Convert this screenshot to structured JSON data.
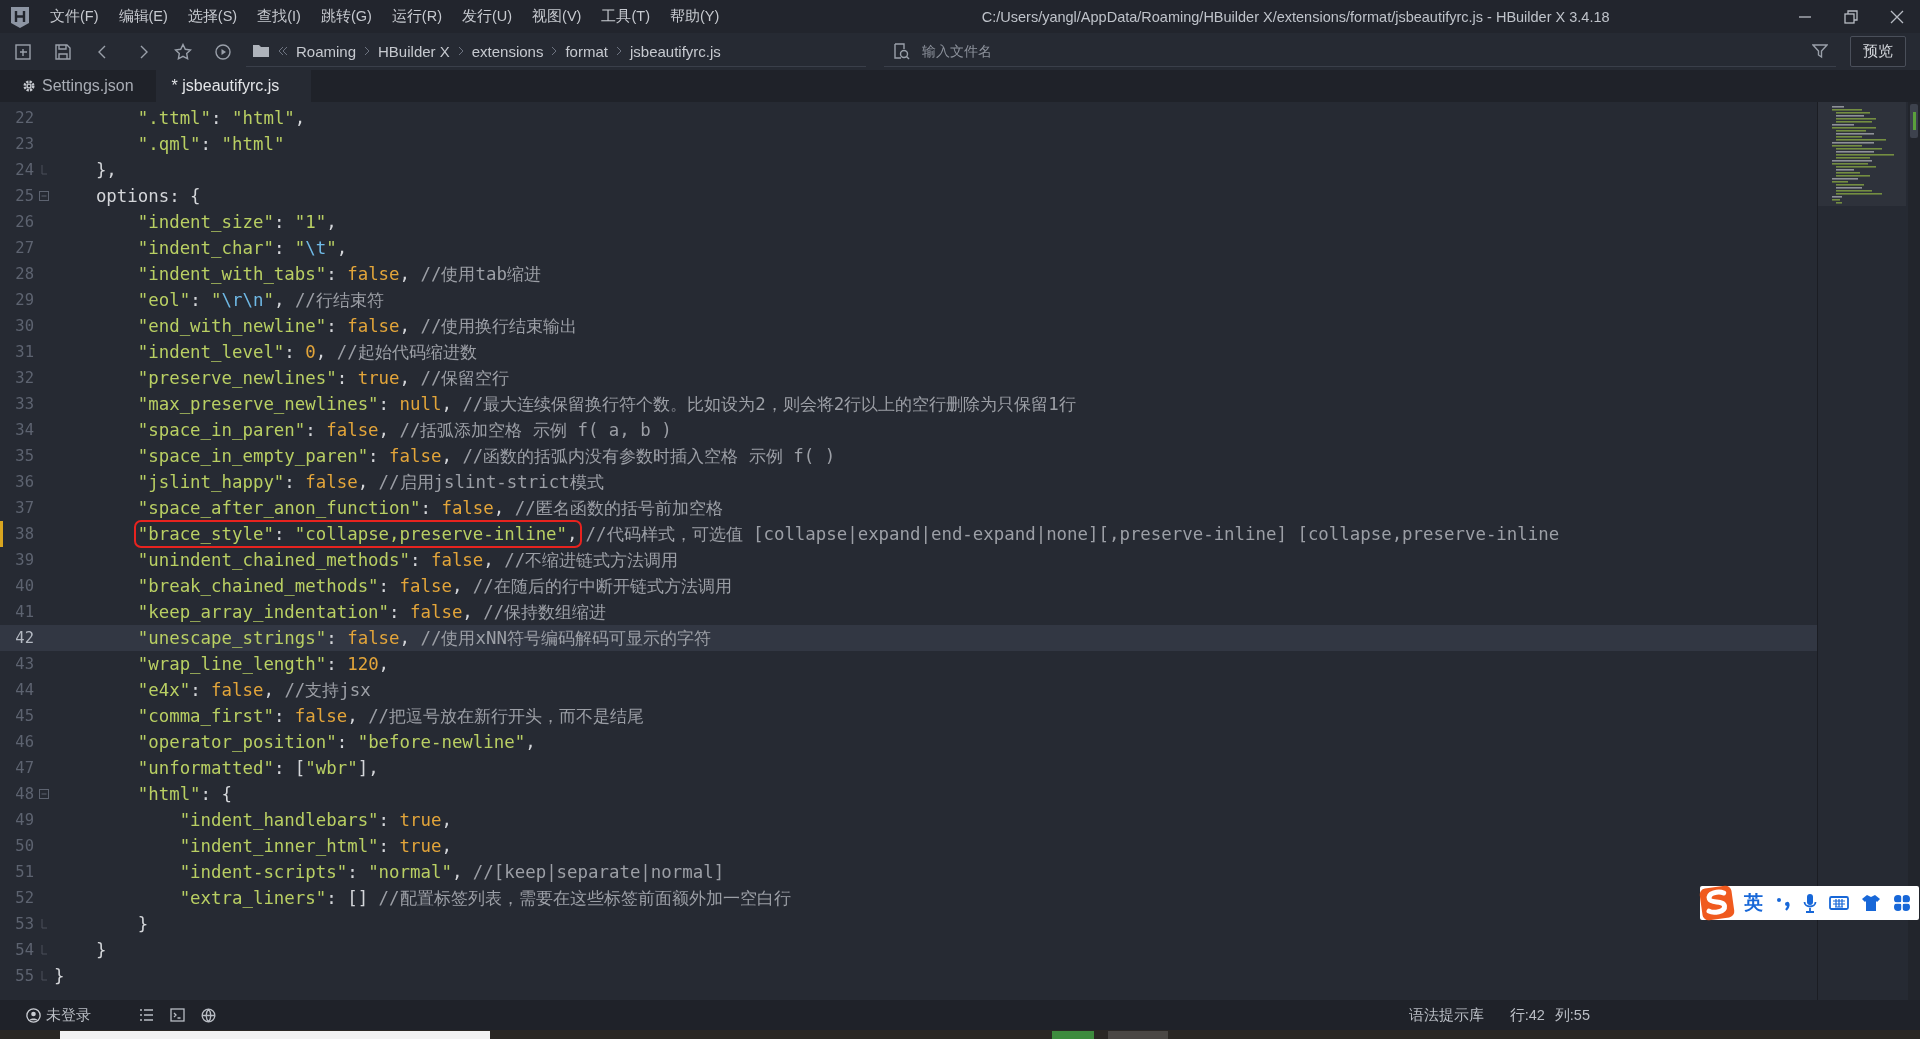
{
  "window": {
    "title": "C:/Users/yangl/AppData/Roaming/HBuilder X/extensions/format/jsbeautifyrc.js - HBuilder X 3.4.18"
  },
  "menu": [
    "文件(F)",
    "编辑(E)",
    "选择(S)",
    "查找(I)",
    "跳转(G)",
    "运行(R)",
    "发行(U)",
    "视图(V)",
    "工具(T)",
    "帮助(Y)"
  ],
  "toolbar": {
    "breadcrumb": [
      "Roaming",
      "HBuilder X",
      "extensions",
      "format",
      "jsbeautifyrc.js"
    ],
    "file_search": {
      "placeholder": "输入文件名"
    },
    "preview_button": "预览"
  },
  "tabs": [
    {
      "kind": "settings",
      "label": "Settings.json",
      "selected": false
    },
    {
      "kind": "file",
      "label": "* jsbeautifyrc.js",
      "selected": true
    }
  ],
  "editor": {
    "lines": [
      {
        "number": "22",
        "selected": false,
        "modified": false,
        "foldable": false,
        "fold_end": false,
        "tokens": [
          {
            "kind": "key",
            "text": "        \".ttml\""
          },
          {
            "kind": "punct",
            "text": ": "
          },
          {
            "kind": "string",
            "text": "\"html\""
          },
          {
            "kind": "punct",
            "text": ","
          }
        ]
      },
      {
        "number": "23",
        "selected": false,
        "modified": false,
        "foldable": false,
        "fold_end": false,
        "tokens": [
          {
            "kind": "key",
            "text": "        \".qml\""
          },
          {
            "kind": "punct",
            "text": ": "
          },
          {
            "kind": "string",
            "text": "\"html\""
          }
        ]
      },
      {
        "number": "24",
        "selected": false,
        "modified": false,
        "foldable": false,
        "fold_end": true,
        "tokens": [
          {
            "kind": "punct",
            "text": "    },"
          }
        ]
      },
      {
        "number": "25",
        "selected": false,
        "modified": false,
        "foldable": true,
        "fold_end": false,
        "tokens": [
          {
            "kind": "ident",
            "text": "    options"
          },
          {
            "kind": "punct",
            "text": ": {"
          }
        ]
      },
      {
        "number": "26",
        "selected": false,
        "modified": false,
        "foldable": false,
        "fold_end": false,
        "tokens": [
          {
            "kind": "key",
            "text": "        \"indent_size\""
          },
          {
            "kind": "punct",
            "text": ": "
          },
          {
            "kind": "string",
            "text": "\"1\""
          },
          {
            "kind": "punct",
            "text": ","
          }
        ]
      },
      {
        "number": "27",
        "selected": false,
        "modified": false,
        "foldable": false,
        "fold_end": false,
        "tokens": [
          {
            "kind": "key",
            "text": "        \"indent_char\""
          },
          {
            "kind": "punct",
            "text": ": "
          },
          {
            "kind": "string",
            "text": "\""
          },
          {
            "kind": "escape",
            "text": "\\t"
          },
          {
            "kind": "string",
            "text": "\""
          },
          {
            "kind": "punct",
            "text": ","
          }
        ]
      },
      {
        "number": "28",
        "selected": false,
        "modified": false,
        "foldable": false,
        "fold_end": false,
        "tokens": [
          {
            "kind": "key",
            "text": "        \"indent_with_tabs\""
          },
          {
            "kind": "punct",
            "text": ": "
          },
          {
            "kind": "keyword",
            "text": "false"
          },
          {
            "kind": "punct",
            "text": ", "
          },
          {
            "kind": "comment",
            "text": "//使用tab缩进"
          }
        ]
      },
      {
        "number": "29",
        "selected": false,
        "modified": false,
        "foldable": false,
        "fold_end": false,
        "tokens": [
          {
            "kind": "key",
            "text": "        \"eol\""
          },
          {
            "kind": "punct",
            "text": ": "
          },
          {
            "kind": "string",
            "text": "\""
          },
          {
            "kind": "escape",
            "text": "\\r\\n"
          },
          {
            "kind": "string",
            "text": "\""
          },
          {
            "kind": "punct",
            "text": ", "
          },
          {
            "kind": "comment",
            "text": "//行结束符"
          }
        ]
      },
      {
        "number": "30",
        "selected": false,
        "modified": false,
        "foldable": false,
        "fold_end": false,
        "tokens": [
          {
            "kind": "key",
            "text": "        \"end_with_newline\""
          },
          {
            "kind": "punct",
            "text": ": "
          },
          {
            "kind": "keyword",
            "text": "false"
          },
          {
            "kind": "punct",
            "text": ", "
          },
          {
            "kind": "comment",
            "text": "//使用换行结束输出"
          }
        ]
      },
      {
        "number": "31",
        "selected": false,
        "modified": false,
        "foldable": false,
        "fold_end": false,
        "tokens": [
          {
            "kind": "key",
            "text": "        \"indent_level\""
          },
          {
            "kind": "punct",
            "text": ": "
          },
          {
            "kind": "number",
            "text": "0"
          },
          {
            "kind": "punct",
            "text": ", "
          },
          {
            "kind": "comment",
            "text": "//起始代码缩进数"
          }
        ]
      },
      {
        "number": "32",
        "selected": false,
        "modified": false,
        "foldable": false,
        "fold_end": false,
        "tokens": [
          {
            "kind": "key",
            "text": "        \"preserve_newlines\""
          },
          {
            "kind": "punct",
            "text": ": "
          },
          {
            "kind": "keyword",
            "text": "true"
          },
          {
            "kind": "punct",
            "text": ", "
          },
          {
            "kind": "comment",
            "text": "//保留空行"
          }
        ]
      },
      {
        "number": "33",
        "selected": false,
        "modified": false,
        "foldable": false,
        "fold_end": false,
        "tokens": [
          {
            "kind": "key",
            "text": "        \"max_preserve_newlines\""
          },
          {
            "kind": "punct",
            "text": ": "
          },
          {
            "kind": "keyword",
            "text": "null"
          },
          {
            "kind": "punct",
            "text": ", "
          },
          {
            "kind": "comment",
            "text": "//最大连续保留换行符个数。比如设为2，则会将2行以上的空行删除为只保留1行"
          }
        ]
      },
      {
        "number": "34",
        "selected": false,
        "modified": false,
        "foldable": false,
        "fold_end": false,
        "tokens": [
          {
            "kind": "key",
            "text": "        \"space_in_paren\""
          },
          {
            "kind": "punct",
            "text": ": "
          },
          {
            "kind": "keyword",
            "text": "false"
          },
          {
            "kind": "punct",
            "text": ", "
          },
          {
            "kind": "comment",
            "text": "//括弧添加空格 示例 f( a, b )"
          }
        ]
      },
      {
        "number": "35",
        "selected": false,
        "modified": false,
        "foldable": false,
        "fold_end": false,
        "tokens": [
          {
            "kind": "key",
            "text": "        \"space_in_empty_paren\""
          },
          {
            "kind": "punct",
            "text": ": "
          },
          {
            "kind": "keyword",
            "text": "false"
          },
          {
            "kind": "punct",
            "text": ", "
          },
          {
            "kind": "comment",
            "text": "//函数的括弧内没有参数时插入空格 示例 f( )"
          }
        ]
      },
      {
        "number": "36",
        "selected": false,
        "modified": false,
        "foldable": false,
        "fold_end": false,
        "tokens": [
          {
            "kind": "key",
            "text": "        \"jslint_happy\""
          },
          {
            "kind": "punct",
            "text": ": "
          },
          {
            "kind": "keyword",
            "text": "false"
          },
          {
            "kind": "punct",
            "text": ", "
          },
          {
            "kind": "comment",
            "text": "//启用jslint-strict模式"
          }
        ]
      },
      {
        "number": "37",
        "selected": false,
        "modified": false,
        "foldable": false,
        "fold_end": false,
        "tokens": [
          {
            "kind": "key",
            "text": "        \"space_after_anon_function\""
          },
          {
            "kind": "punct",
            "text": ": "
          },
          {
            "kind": "keyword",
            "text": "false"
          },
          {
            "kind": "punct",
            "text": ", "
          },
          {
            "kind": "comment",
            "text": "//匿名函数的括号前加空格"
          }
        ]
      },
      {
        "number": "38",
        "selected": false,
        "modified": true,
        "foldable": false,
        "fold_end": false,
        "marked": [
          {
            "kind": "key",
            "text": "\"brace_style\""
          },
          {
            "kind": "punct",
            "text": ": "
          },
          {
            "kind": "string",
            "text": "\"collapse,preserve-inline\""
          },
          {
            "kind": "punct",
            "text": ","
          }
        ],
        "tokens": [
          {
            "kind": "comment",
            "text": "//代码样式，可选值 [collapse|expand|end-expand|none][,preserve-inline] [collapse,preserve-inline"
          }
        ]
      },
      {
        "number": "39",
        "selected": false,
        "modified": false,
        "foldable": false,
        "fold_end": false,
        "tokens": [
          {
            "kind": "key",
            "text": "        \"unindent_chained_methods\""
          },
          {
            "kind": "punct",
            "text": ": "
          },
          {
            "kind": "keyword",
            "text": "false"
          },
          {
            "kind": "punct",
            "text": ", "
          },
          {
            "kind": "comment",
            "text": "//不缩进链式方法调用"
          }
        ]
      },
      {
        "number": "40",
        "selected": false,
        "modified": false,
        "foldable": false,
        "fold_end": false,
        "tokens": [
          {
            "kind": "key",
            "text": "        \"break_chained_methods\""
          },
          {
            "kind": "punct",
            "text": ": "
          },
          {
            "kind": "keyword",
            "text": "false"
          },
          {
            "kind": "punct",
            "text": ", "
          },
          {
            "kind": "comment",
            "text": "//在随后的行中断开链式方法调用"
          }
        ]
      },
      {
        "number": "41",
        "selected": false,
        "modified": false,
        "foldable": false,
        "fold_end": false,
        "tokens": [
          {
            "kind": "key",
            "text": "        \"keep_array_indentation\""
          },
          {
            "kind": "punct",
            "text": ": "
          },
          {
            "kind": "keyword",
            "text": "false"
          },
          {
            "kind": "punct",
            "text": ", "
          },
          {
            "kind": "comment",
            "text": "//保持数组缩进"
          }
        ]
      },
      {
        "number": "42",
        "selected": true,
        "modified": false,
        "foldable": false,
        "fold_end": false,
        "tokens": [
          {
            "kind": "key",
            "text": "        \"unescape_strings\""
          },
          {
            "kind": "punct",
            "text": ": "
          },
          {
            "kind": "keyword",
            "text": "false"
          },
          {
            "kind": "punct",
            "text": ", "
          },
          {
            "kind": "comment",
            "text": "//使用xNN符号编码解码可显示的字符"
          }
        ]
      },
      {
        "number": "43",
        "selected": false,
        "modified": false,
        "foldable": false,
        "fold_end": false,
        "tokens": [
          {
            "kind": "key",
            "text": "        \"wrap_line_length\""
          },
          {
            "kind": "punct",
            "text": ": "
          },
          {
            "kind": "number",
            "text": "120"
          },
          {
            "kind": "punct",
            "text": ","
          }
        ]
      },
      {
        "number": "44",
        "selected": false,
        "modified": false,
        "foldable": false,
        "fold_end": false,
        "tokens": [
          {
            "kind": "key",
            "text": "        \"e4x\""
          },
          {
            "kind": "punct",
            "text": ": "
          },
          {
            "kind": "keyword",
            "text": "false"
          },
          {
            "kind": "punct",
            "text": ", "
          },
          {
            "kind": "comment",
            "text": "//支持jsx"
          }
        ]
      },
      {
        "number": "45",
        "selected": false,
        "modified": false,
        "foldable": false,
        "fold_end": false,
        "tokens": [
          {
            "kind": "key",
            "text": "        \"comma_first\""
          },
          {
            "kind": "punct",
            "text": ": "
          },
          {
            "kind": "keyword",
            "text": "false"
          },
          {
            "kind": "punct",
            "text": ", "
          },
          {
            "kind": "comment",
            "text": "//把逗号放在新行开头，而不是结尾"
          }
        ]
      },
      {
        "number": "46",
        "selected": false,
        "modified": false,
        "foldable": false,
        "fold_end": false,
        "tokens": [
          {
            "kind": "key",
            "text": "        \"operator_position\""
          },
          {
            "kind": "punct",
            "text": ": "
          },
          {
            "kind": "string",
            "text": "\"before-newline\""
          },
          {
            "kind": "punct",
            "text": ","
          }
        ]
      },
      {
        "number": "47",
        "selected": false,
        "modified": false,
        "foldable": false,
        "fold_end": false,
        "tokens": [
          {
            "kind": "key",
            "text": "        \"unformatted\""
          },
          {
            "kind": "punct",
            "text": ": ["
          },
          {
            "kind": "string",
            "text": "\"wbr\""
          },
          {
            "kind": "punct",
            "text": "],"
          }
        ]
      },
      {
        "number": "48",
        "selected": false,
        "modified": false,
        "foldable": true,
        "fold_end": false,
        "tokens": [
          {
            "kind": "key",
            "text": "        \"html\""
          },
          {
            "kind": "punct",
            "text": ": {"
          }
        ]
      },
      {
        "number": "49",
        "selected": false,
        "modified": false,
        "foldable": false,
        "fold_end": false,
        "tokens": [
          {
            "kind": "key",
            "text": "            \"indent_handlebars\""
          },
          {
            "kind": "punct",
            "text": ": "
          },
          {
            "kind": "keyword",
            "text": "true"
          },
          {
            "kind": "punct",
            "text": ","
          }
        ]
      },
      {
        "number": "50",
        "selected": false,
        "modified": false,
        "foldable": false,
        "fold_end": false,
        "tokens": [
          {
            "kind": "key",
            "text": "            \"indent_inner_html\""
          },
          {
            "kind": "punct",
            "text": ": "
          },
          {
            "kind": "keyword",
            "text": "true"
          },
          {
            "kind": "punct",
            "text": ","
          }
        ]
      },
      {
        "number": "51",
        "selected": false,
        "modified": false,
        "foldable": false,
        "fold_end": false,
        "tokens": [
          {
            "kind": "key",
            "text": "            \"indent-scripts\""
          },
          {
            "kind": "punct",
            "text": ": "
          },
          {
            "kind": "string",
            "text": "\"normal\""
          },
          {
            "kind": "punct",
            "text": ", "
          },
          {
            "kind": "comment",
            "text": "//[keep|separate|normal]"
          }
        ]
      },
      {
        "number": "52",
        "selected": false,
        "modified": false,
        "foldable": false,
        "fold_end": false,
        "tokens": [
          {
            "kind": "key",
            "text": "            \"extra_liners\""
          },
          {
            "kind": "punct",
            "text": ": [] "
          },
          {
            "kind": "comment",
            "text": "//配置标签列表，需要在这些标签前面额外加一空白行"
          }
        ]
      },
      {
        "number": "53",
        "selected": false,
        "modified": false,
        "foldable": false,
        "fold_end": true,
        "tokens": [
          {
            "kind": "punct",
            "text": "        }"
          }
        ]
      },
      {
        "number": "54",
        "selected": false,
        "modified": false,
        "foldable": false,
        "fold_end": true,
        "tokens": [
          {
            "kind": "punct",
            "text": "    }"
          }
        ]
      },
      {
        "number": "55",
        "selected": false,
        "modified": false,
        "foldable": false,
        "fold_end": true,
        "tokens": [
          {
            "kind": "punct",
            "text": "}"
          }
        ]
      }
    ]
  },
  "ime_toolbar": {
    "mode": "英"
  },
  "status_bar": {
    "user": "未登录",
    "syntax_library": "语法提示库",
    "line": "行:42",
    "column": "列:55"
  }
}
